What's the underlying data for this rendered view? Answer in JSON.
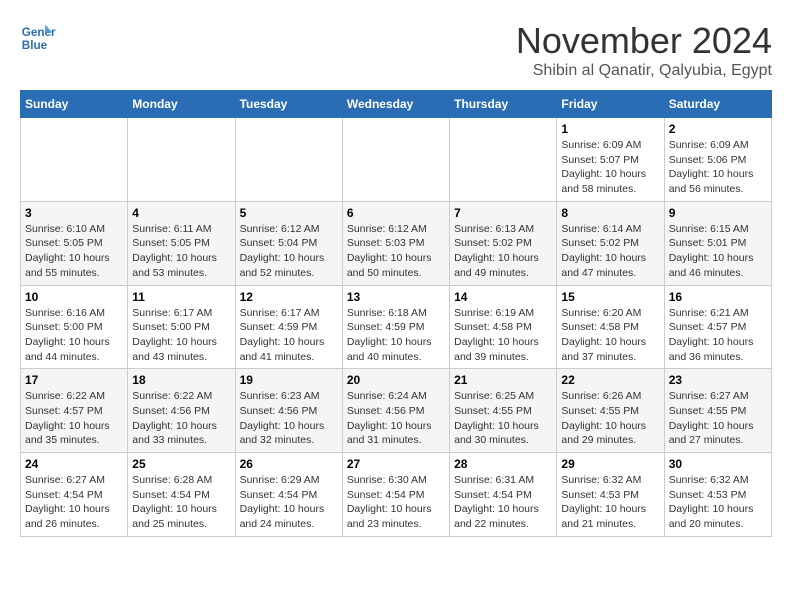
{
  "header": {
    "logo_line1": "General",
    "logo_line2": "Blue",
    "month": "November 2024",
    "location": "Shibin al Qanatir, Qalyubia, Egypt"
  },
  "weekdays": [
    "Sunday",
    "Monday",
    "Tuesday",
    "Wednesday",
    "Thursday",
    "Friday",
    "Saturday"
  ],
  "weeks": [
    [
      {
        "day": "",
        "info": ""
      },
      {
        "day": "",
        "info": ""
      },
      {
        "day": "",
        "info": ""
      },
      {
        "day": "",
        "info": ""
      },
      {
        "day": "",
        "info": ""
      },
      {
        "day": "1",
        "info": "Sunrise: 6:09 AM\nSunset: 5:07 PM\nDaylight: 10 hours and 58 minutes."
      },
      {
        "day": "2",
        "info": "Sunrise: 6:09 AM\nSunset: 5:06 PM\nDaylight: 10 hours and 56 minutes."
      }
    ],
    [
      {
        "day": "3",
        "info": "Sunrise: 6:10 AM\nSunset: 5:05 PM\nDaylight: 10 hours and 55 minutes."
      },
      {
        "day": "4",
        "info": "Sunrise: 6:11 AM\nSunset: 5:05 PM\nDaylight: 10 hours and 53 minutes."
      },
      {
        "day": "5",
        "info": "Sunrise: 6:12 AM\nSunset: 5:04 PM\nDaylight: 10 hours and 52 minutes."
      },
      {
        "day": "6",
        "info": "Sunrise: 6:12 AM\nSunset: 5:03 PM\nDaylight: 10 hours and 50 minutes."
      },
      {
        "day": "7",
        "info": "Sunrise: 6:13 AM\nSunset: 5:02 PM\nDaylight: 10 hours and 49 minutes."
      },
      {
        "day": "8",
        "info": "Sunrise: 6:14 AM\nSunset: 5:02 PM\nDaylight: 10 hours and 47 minutes."
      },
      {
        "day": "9",
        "info": "Sunrise: 6:15 AM\nSunset: 5:01 PM\nDaylight: 10 hours and 46 minutes."
      }
    ],
    [
      {
        "day": "10",
        "info": "Sunrise: 6:16 AM\nSunset: 5:00 PM\nDaylight: 10 hours and 44 minutes."
      },
      {
        "day": "11",
        "info": "Sunrise: 6:17 AM\nSunset: 5:00 PM\nDaylight: 10 hours and 43 minutes."
      },
      {
        "day": "12",
        "info": "Sunrise: 6:17 AM\nSunset: 4:59 PM\nDaylight: 10 hours and 41 minutes."
      },
      {
        "day": "13",
        "info": "Sunrise: 6:18 AM\nSunset: 4:59 PM\nDaylight: 10 hours and 40 minutes."
      },
      {
        "day": "14",
        "info": "Sunrise: 6:19 AM\nSunset: 4:58 PM\nDaylight: 10 hours and 39 minutes."
      },
      {
        "day": "15",
        "info": "Sunrise: 6:20 AM\nSunset: 4:58 PM\nDaylight: 10 hours and 37 minutes."
      },
      {
        "day": "16",
        "info": "Sunrise: 6:21 AM\nSunset: 4:57 PM\nDaylight: 10 hours and 36 minutes."
      }
    ],
    [
      {
        "day": "17",
        "info": "Sunrise: 6:22 AM\nSunset: 4:57 PM\nDaylight: 10 hours and 35 minutes."
      },
      {
        "day": "18",
        "info": "Sunrise: 6:22 AM\nSunset: 4:56 PM\nDaylight: 10 hours and 33 minutes."
      },
      {
        "day": "19",
        "info": "Sunrise: 6:23 AM\nSunset: 4:56 PM\nDaylight: 10 hours and 32 minutes."
      },
      {
        "day": "20",
        "info": "Sunrise: 6:24 AM\nSunset: 4:56 PM\nDaylight: 10 hours and 31 minutes."
      },
      {
        "day": "21",
        "info": "Sunrise: 6:25 AM\nSunset: 4:55 PM\nDaylight: 10 hours and 30 minutes."
      },
      {
        "day": "22",
        "info": "Sunrise: 6:26 AM\nSunset: 4:55 PM\nDaylight: 10 hours and 29 minutes."
      },
      {
        "day": "23",
        "info": "Sunrise: 6:27 AM\nSunset: 4:55 PM\nDaylight: 10 hours and 27 minutes."
      }
    ],
    [
      {
        "day": "24",
        "info": "Sunrise: 6:27 AM\nSunset: 4:54 PM\nDaylight: 10 hours and 26 minutes."
      },
      {
        "day": "25",
        "info": "Sunrise: 6:28 AM\nSunset: 4:54 PM\nDaylight: 10 hours and 25 minutes."
      },
      {
        "day": "26",
        "info": "Sunrise: 6:29 AM\nSunset: 4:54 PM\nDaylight: 10 hours and 24 minutes."
      },
      {
        "day": "27",
        "info": "Sunrise: 6:30 AM\nSunset: 4:54 PM\nDaylight: 10 hours and 23 minutes."
      },
      {
        "day": "28",
        "info": "Sunrise: 6:31 AM\nSunset: 4:54 PM\nDaylight: 10 hours and 22 minutes."
      },
      {
        "day": "29",
        "info": "Sunrise: 6:32 AM\nSunset: 4:53 PM\nDaylight: 10 hours and 21 minutes."
      },
      {
        "day": "30",
        "info": "Sunrise: 6:32 AM\nSunset: 4:53 PM\nDaylight: 10 hours and 20 minutes."
      }
    ]
  ]
}
